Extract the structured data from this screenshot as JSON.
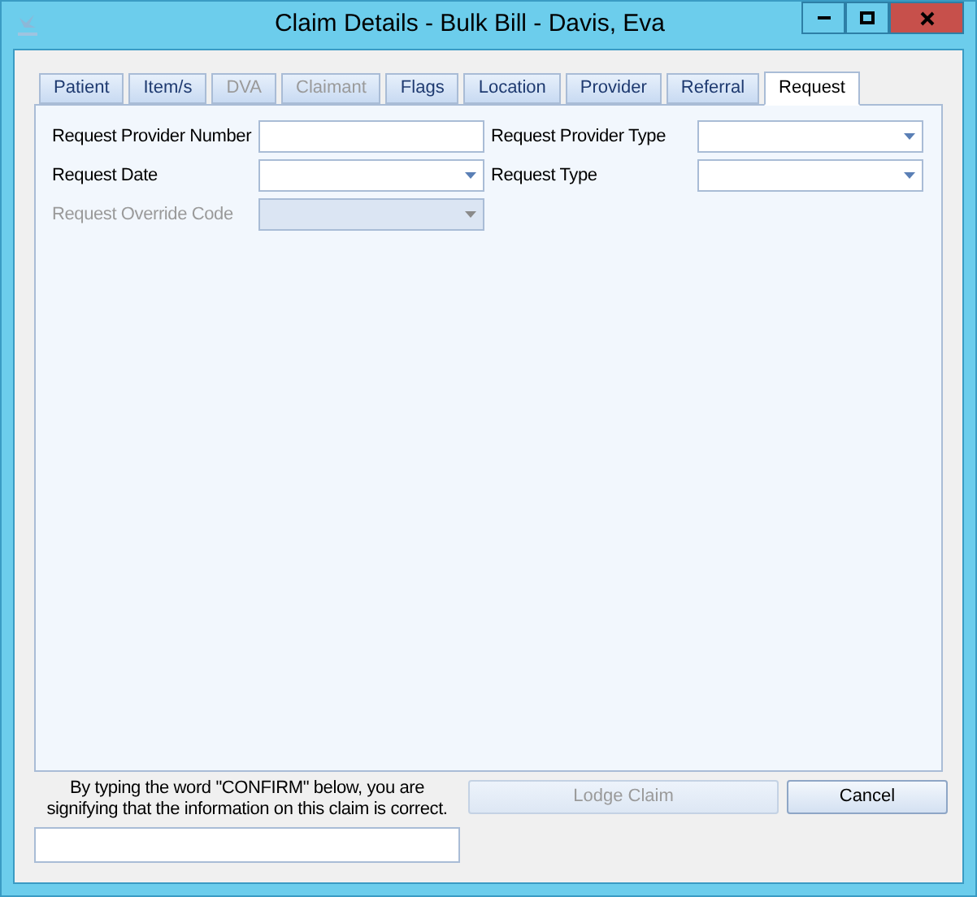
{
  "window": {
    "title": "Claim Details - Bulk Bill - Davis, Eva"
  },
  "tabs": [
    {
      "label": "Patient",
      "selected": false,
      "disabled": false
    },
    {
      "label": "Item/s",
      "selected": false,
      "disabled": false
    },
    {
      "label": "DVA",
      "selected": false,
      "disabled": true
    },
    {
      "label": "Claimant",
      "selected": false,
      "disabled": true
    },
    {
      "label": "Flags",
      "selected": false,
      "disabled": false
    },
    {
      "label": "Location",
      "selected": false,
      "disabled": false
    },
    {
      "label": "Provider",
      "selected": false,
      "disabled": false
    },
    {
      "label": "Referral",
      "selected": false,
      "disabled": false
    },
    {
      "label": "Request",
      "selected": true,
      "disabled": false
    }
  ],
  "fields": [
    {
      "label": "Request Provider Number",
      "kind": "text",
      "disabled": false
    },
    {
      "label": "Request Provider Type",
      "kind": "dropdown",
      "disabled": false
    },
    {
      "label": "Request Date",
      "kind": "dropdown",
      "disabled": false
    },
    {
      "label": "Request Type",
      "kind": "dropdown",
      "disabled": false
    },
    {
      "label": "Request Override Code",
      "kind": "dropdown",
      "disabled": true
    }
  ],
  "confirm": {
    "text": "By typing the word \"CONFIRM\" below, you are signifying that the information on this claim is correct."
  },
  "buttons": [
    {
      "label": "Lodge Claim",
      "disabled": true
    },
    {
      "label": "Cancel",
      "disabled": false
    }
  ]
}
